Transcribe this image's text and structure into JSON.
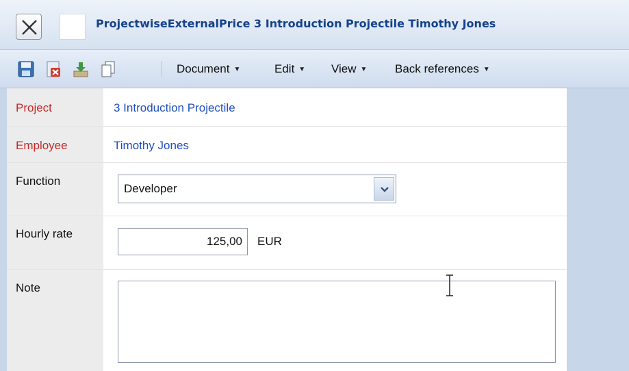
{
  "window": {
    "title": "ProjectwiseExternalPrice 3 Introduction Projectile Timothy Jones"
  },
  "toolbar": {
    "icons": [
      "save-icon",
      "delete-icon",
      "download-icon",
      "copy-icon"
    ],
    "menus": [
      "Document",
      "Edit",
      "View",
      "Back references"
    ]
  },
  "form": {
    "project": {
      "label": "Project",
      "value": "3 Introduction Projectile"
    },
    "employee": {
      "label": "Employee",
      "value": "Timothy Jones"
    },
    "function": {
      "label": "Function",
      "value": "Developer"
    },
    "hourly_rate": {
      "label": "Hourly rate",
      "value": "125,00",
      "unit": "EUR"
    },
    "note": {
      "label": "Note",
      "value": ""
    }
  },
  "colors": {
    "title_text": "#15428b",
    "required_label": "#c8282a",
    "link_value": "#1f4fc1"
  }
}
